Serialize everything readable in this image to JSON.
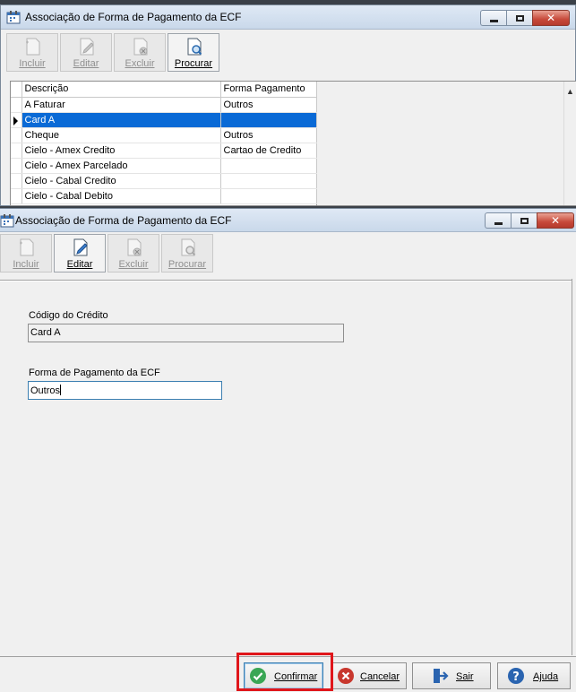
{
  "back_window": {
    "title": "Associação de Forma de Pagamento da ECF",
    "toolbar": [
      {
        "label": "Incluir",
        "enabled": false,
        "icon": "new-document-icon"
      },
      {
        "label": "Editar",
        "enabled": false,
        "icon": "edit-document-icon"
      },
      {
        "label": "Excluir",
        "enabled": false,
        "icon": "delete-document-icon"
      },
      {
        "label": "Procurar",
        "enabled": true,
        "icon": "search-document-icon"
      }
    ],
    "grid": {
      "columns": [
        "Descrição",
        "Forma Pagamento"
      ],
      "rows": [
        [
          "A Faturar",
          "Outros"
        ],
        [
          "Card A",
          ""
        ],
        [
          "Cheque",
          "Outros"
        ],
        [
          "Cielo - Amex Credito",
          "Cartao de Credito"
        ],
        [
          "Cielo - Amex Parcelado",
          ""
        ],
        [
          "Cielo - Cabal Credito",
          ""
        ],
        [
          "Cielo - Cabal Debito",
          ""
        ]
      ],
      "selected_row": 1
    }
  },
  "front_window": {
    "title": "Associação de Forma de Pagamento da ECF",
    "toolbar": [
      {
        "label": "Incluir",
        "enabled": false,
        "icon": "new-document-icon"
      },
      {
        "label": "Editar",
        "enabled": true,
        "icon": "edit-document-icon"
      },
      {
        "label": "Excluir",
        "enabled": false,
        "icon": "delete-document-icon"
      },
      {
        "label": "Procurar",
        "enabled": false,
        "icon": "search-document-icon"
      }
    ],
    "form": {
      "codigo_label": "Código do Crédito",
      "codigo_value": "Card A",
      "forma_label": "Forma de Pagamento da ECF",
      "forma_value": "Outros"
    },
    "buttons": {
      "confirmar": "Confirmar",
      "cancelar": "Cancelar",
      "sair": "Sair",
      "ajuda": "Ajuda"
    }
  },
  "colors": {
    "selection": "#0a6ad6",
    "highlight_box": "#e0161b",
    "confirm_green": "#3aa655",
    "cancel_red": "#c8372d",
    "help_blue": "#2a64b0"
  }
}
